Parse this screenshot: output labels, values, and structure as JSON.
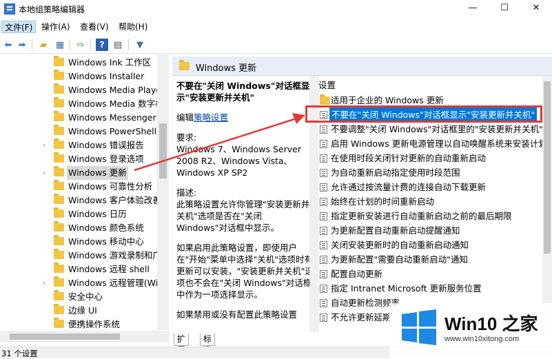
{
  "window": {
    "title": "本地组策略编辑器",
    "minimize": "—",
    "maximize": "☐",
    "close": "✕"
  },
  "menu": [
    "文件(F)",
    "操作(A)",
    "查看(V)",
    "帮助(H)"
  ],
  "toolbar_icons": [
    "back-arrow-icon",
    "forward-arrow-icon",
    "up-folder-icon",
    "show-tree-icon",
    "export-icon",
    "help-icon",
    "properties-icon",
    "filter-icon"
  ],
  "tree": {
    "items": [
      {
        "label": "Windows Ink 工作区",
        "expandable": false
      },
      {
        "label": "Windows Installer",
        "expandable": false
      },
      {
        "label": "Windows Media Playe",
        "expandable": false
      },
      {
        "label": "Windows Media 数字权",
        "expandable": false
      },
      {
        "label": "Windows Messenger",
        "expandable": false
      },
      {
        "label": "Windows PowerShell",
        "expandable": false
      },
      {
        "label": "Windows 错误报告",
        "expandable": true
      },
      {
        "label": "Windows 登录选项",
        "expandable": false
      },
      {
        "label": "Windows 更新",
        "expandable": true,
        "selected": true
      },
      {
        "label": "Windows 可靠性分析",
        "expandable": false
      },
      {
        "label": "Windows 客户体验改善",
        "expandable": false
      },
      {
        "label": "Windows 日历",
        "expandable": false
      },
      {
        "label": "Windows 颜色系统",
        "expandable": false
      },
      {
        "label": "Windows 移动中心",
        "expandable": false
      },
      {
        "label": "Windows 游戏录制和广",
        "expandable": false
      },
      {
        "label": "Windows 远程 shell",
        "expandable": false
      },
      {
        "label": "Windows 远程管理(Wir",
        "expandable": true
      },
      {
        "label": "安全中心",
        "expandable": false
      },
      {
        "label": "边缘 UI",
        "expandable": false
      },
      {
        "label": "便携操作系统",
        "expandable": false
      }
    ]
  },
  "right": {
    "header": "Windows 更新",
    "desc": {
      "title": "不要在\"关闭 Windows\"对话框显示\"安装更新并关机\"",
      "edit_prefix": "编辑",
      "edit_link": "策略设置",
      "req_label": "要求:",
      "req_text": "Windows 7、Windows Server 2008 R2、Windows Vista、Windows XP SP2",
      "desc_label": "描述:",
      "desc_text": "此策略设置允许你管理\"安装更新并关机\"选项是否在\"关闭 Windows\"对话框中显示。",
      "desc_text2": "如果启用此策略设置，即使用户在\"开始\"菜单中选择\"关机\"选项时有更新可以安装，\"安装更新并关机\"选项也不会在\"关闭 Windows\"对话框中作为一项选择显示。",
      "desc_text3": "如果禁用或没有配置此策略设置"
    },
    "list_header": "设置",
    "settings": [
      {
        "label": "适用于企业的 Windows 更新",
        "type": "folder"
      },
      {
        "label": "不要在\"关闭 Windows\"对话框显示\"安装更新并关机\"",
        "type": "setting",
        "selected": true
      },
      {
        "label": "不要调整\"关闭 Windows\"对话框里的\"安装更新并关机\"的",
        "type": "setting"
      },
      {
        "label": "启用 Windows 更新电源管理以自动唤醒系统来安装计划",
        "type": "setting"
      },
      {
        "label": "在使用时段关闭针对更新的自动重新启动",
        "type": "setting"
      },
      {
        "label": "为自动重新启动指定使用时段范围",
        "type": "setting"
      },
      {
        "label": "允许通过按流量计费的连接自动下载更新",
        "type": "setting"
      },
      {
        "label": "始终在计划的时间重新启动",
        "type": "setting"
      },
      {
        "label": "指定更新安装进行自动重新启动之前的最后期限",
        "type": "setting"
      },
      {
        "label": "为更新配置自动重新启动提醒通知",
        "type": "setting"
      },
      {
        "label": "关闭安装更新时的自动重新启动通知",
        "type": "setting"
      },
      {
        "label": "为更新配置\"需要自动重新启动\"通知",
        "type": "setting"
      },
      {
        "label": "配置自动更新",
        "type": "setting"
      },
      {
        "label": "指定 Intranet Microsoft 更新服务位置",
        "type": "setting"
      },
      {
        "label": "自动更新检测频率",
        "type": "setting"
      },
      {
        "label": "不允许更新延期",
        "type": "setting"
      }
    ]
  },
  "tabs": [
    "扩展",
    "标准"
  ],
  "status": "31 个设置",
  "watermark": {
    "brand": "Win10 之家",
    "url": "www.win10xitong.com"
  },
  "colors": {
    "selection": "#0078d7",
    "highlight_box": "#e53935",
    "header_bg": "#e8eef7"
  }
}
